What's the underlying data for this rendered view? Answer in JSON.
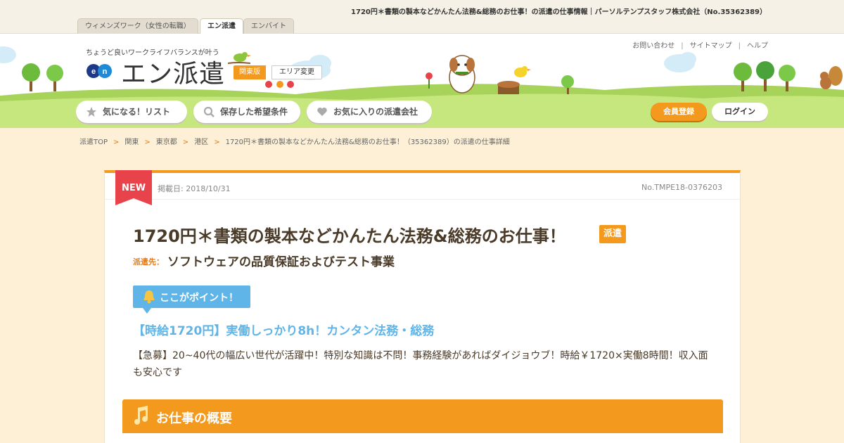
{
  "page": {
    "heading": "1720円＊書類の製本などかんたん法務&総務のお仕事！の派遣の仕事情報｜パーソルテンプスタッフ株式会社（No.35362389）"
  },
  "site_tabs": [
    {
      "label": "ウィメンズワーク（女性の転職）",
      "active": false
    },
    {
      "label": "エン派遣",
      "active": true
    },
    {
      "label": "エンバイト",
      "active": false
    }
  ],
  "header": {
    "tagline": "ちょうど良いワークライフバランスが叶う",
    "logo_text": "エン派遣",
    "logo_mark": "en",
    "area_current": "関東版",
    "area_change": "エリア変更",
    "util_links": [
      "お問い合わせ",
      "サイトマップ",
      "ヘルプ"
    ],
    "nav": [
      {
        "label": "気になる！リスト",
        "icon": "star-icon"
      },
      {
        "label": "保存した希望条件",
        "icon": "search-icon"
      },
      {
        "label": "お気に入りの派遣会社",
        "icon": "heart-icon"
      }
    ],
    "register_label": "会員登録",
    "login_label": "ログイン"
  },
  "breadcrumb": [
    "派遣TOP",
    "関東",
    "東京都",
    "港区",
    "1720円＊書類の製本などかんたん法務&総務のお仕事！（35362389）の派遣の仕事詳細"
  ],
  "job": {
    "new_label": "NEW",
    "posted": "掲載日: 2018/10/31",
    "job_no": "No.TMPE18-0376203",
    "title": "1720円＊書類の製本などかんたん法務&総務のお仕事！",
    "type_badge": "派遣",
    "dispatch_label": "派遣先：",
    "dispatch_value": "ソフトウェアの品質保証およびテスト事業",
    "point_label": "ここがポイント！",
    "highlight": "【時給1720円】実働しっかり8h！カンタン法務・総務",
    "description": "【急募】20~40代の幅広い世代が活躍中！特別な知識は不問！事務経験があればダイジョウブ！時給￥1720×実働8時間！収入面も安心です",
    "section_title": "お仕事の概要"
  },
  "colors": {
    "accent_orange": "#f39a1e",
    "point_blue": "#5fb5e8",
    "new_red": "#e8434b",
    "background": "#fdf0d6"
  }
}
